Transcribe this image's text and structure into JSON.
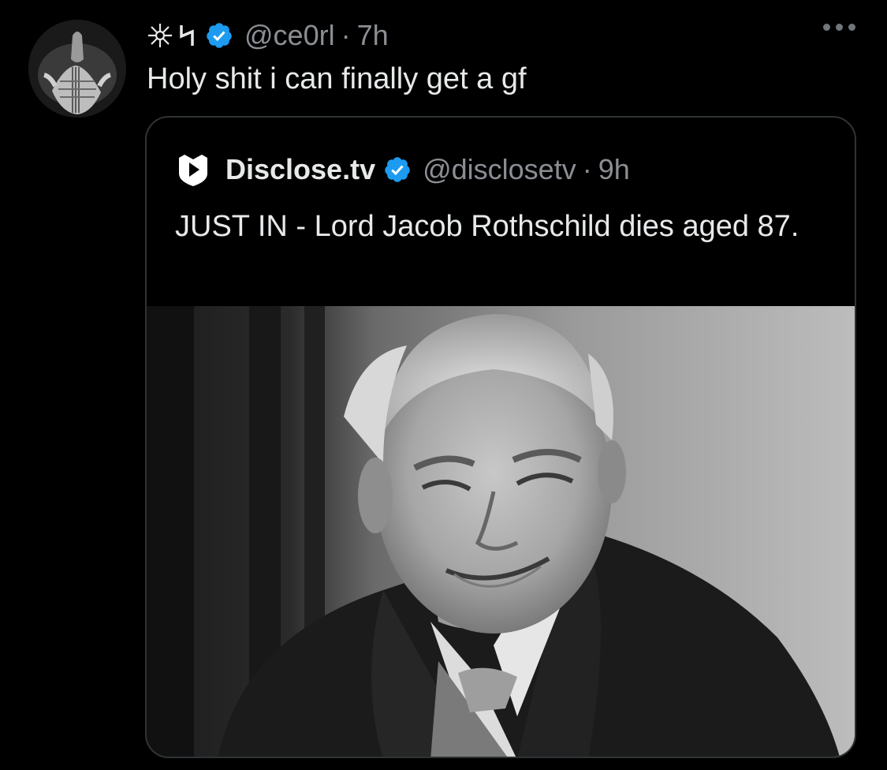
{
  "tweet": {
    "avatar_icon": "profile-avatar-icon",
    "name_icons": [
      "sparkle-icon",
      "lightning-icon"
    ],
    "handle": "@ce0rl",
    "separator": "·",
    "time": "7h",
    "text": "Holy shit i can finally get a gf",
    "more_icon": "more-options-icon"
  },
  "quoted": {
    "logo_icon": "disclose-tv-logo-icon",
    "name": "Disclose.tv",
    "handle": "@disclosetv",
    "separator": "·",
    "time": "9h",
    "text": "JUST IN - Lord Jacob Rothschild dies aged 87.",
    "image": "black-and-white-portrait-photo"
  },
  "colors": {
    "background": "#000000",
    "text": "#e7e9ea",
    "secondary_text": "#8b8f94",
    "verified_blue": "#1d9bf0",
    "border": "#2f3336"
  }
}
